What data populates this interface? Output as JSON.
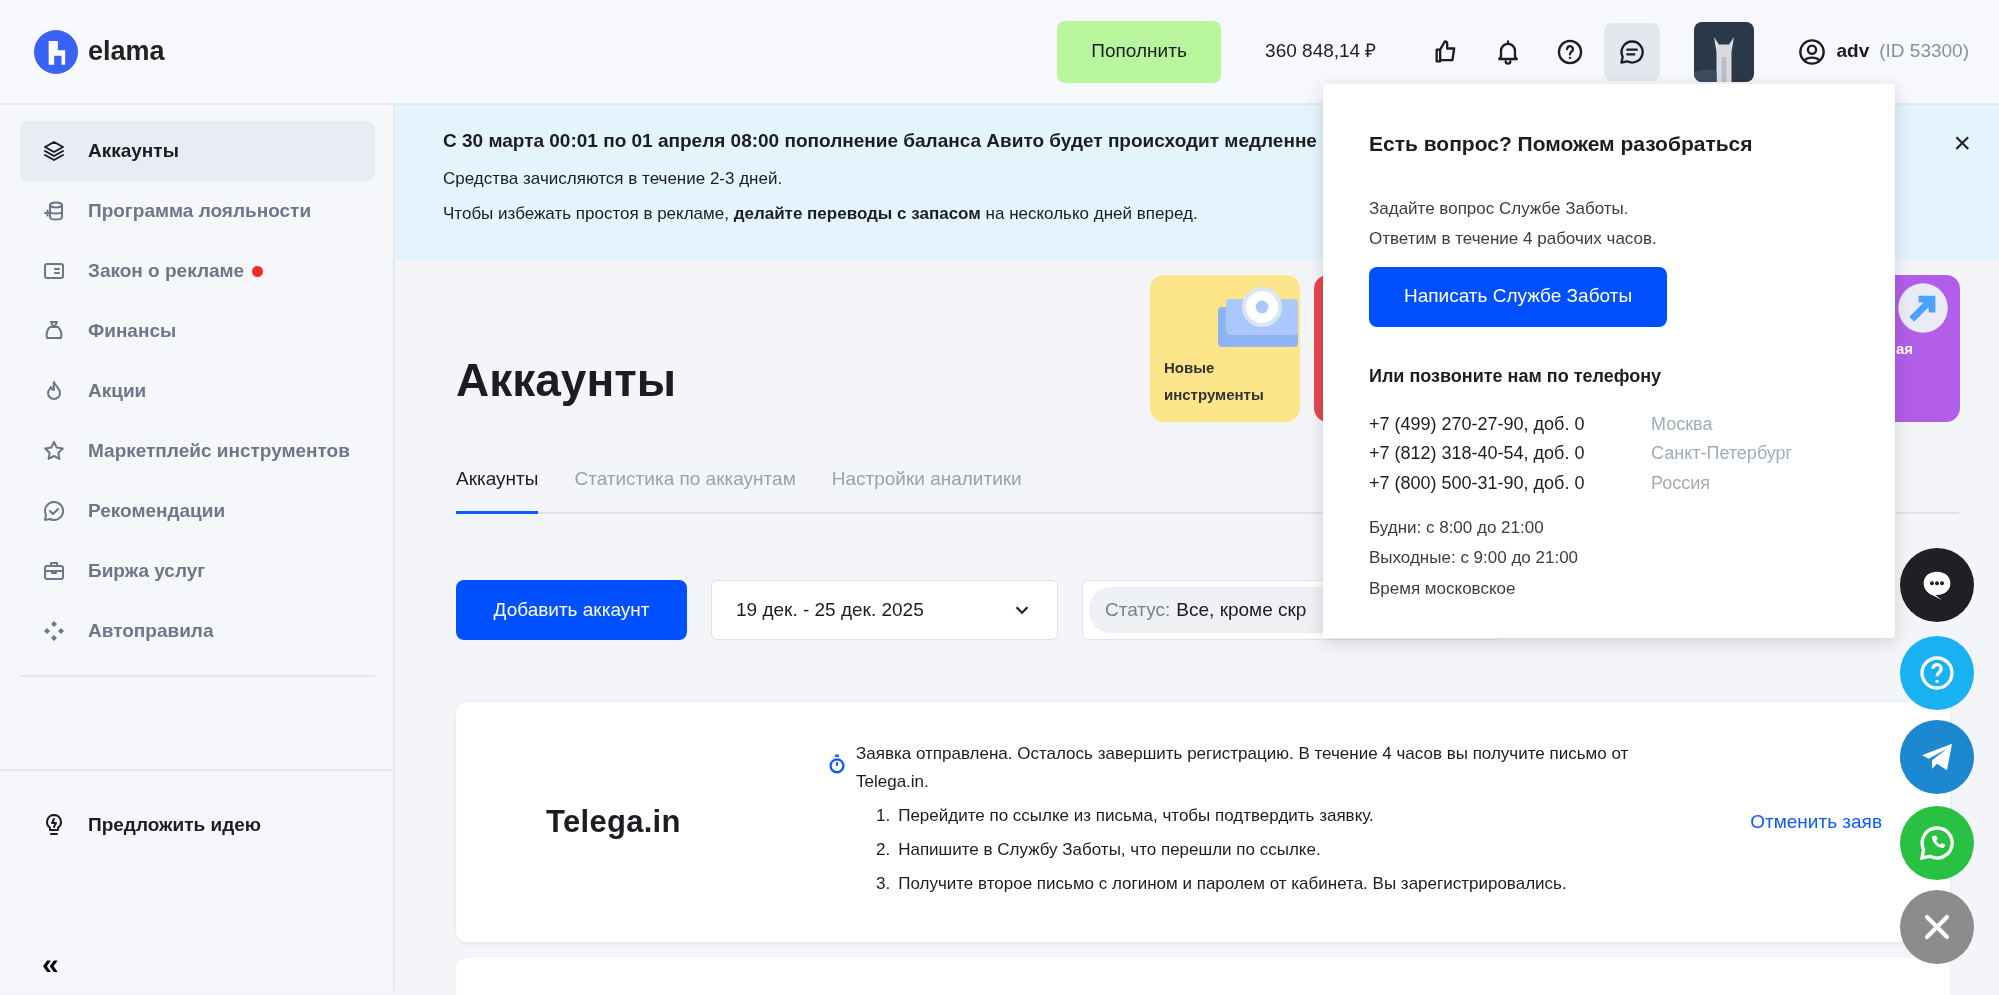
{
  "header": {
    "logo": "elama",
    "topup_button": "Пополнить",
    "balance": "360 848,14 ₽",
    "chat_open": true,
    "user": {
      "name": "adv",
      "id": "(ID 53300)"
    }
  },
  "sidebar": {
    "items": [
      {
        "label": "Аккаунты",
        "kind": "layers",
        "selected": true,
        "badge": false
      },
      {
        "label": "Программа лояльности",
        "kind": "coins",
        "selected": false,
        "badge": false
      },
      {
        "label": "Закон о рекламе",
        "kind": "card",
        "selected": false,
        "badge": true
      },
      {
        "label": "Финансы",
        "kind": "bag",
        "selected": false,
        "badge": false
      },
      {
        "label": "Акции",
        "kind": "fire",
        "selected": false,
        "badge": false
      },
      {
        "label": "Маркетплейс инструментов",
        "kind": "star",
        "selected": false,
        "badge": false
      },
      {
        "label": "Рекомендации",
        "kind": "check",
        "selected": false,
        "badge": false
      },
      {
        "label": "Биржа услуг",
        "kind": "case",
        "selected": false,
        "badge": false
      },
      {
        "label": "Автоправила",
        "kind": "diamonds",
        "selected": false,
        "badge": false
      }
    ],
    "suggest": "Предложить идею",
    "collapse": "«"
  },
  "banner": {
    "close": "×",
    "title": "С 30 марта 00:01 по 01 апреля 08:00 пополнение баланса Авито будет происходит медленне",
    "lines": [
      "Средства зачисляются в течение 2-3 дней.",
      "Чтобы избежать простоя в рекламе, **делайте переводы с запасом** на несколько дней вперед."
    ]
  },
  "promo_cards": [
    {
      "kind": "tools",
      "label": "Новые инструменты",
      "color": "#fde68a"
    },
    {
      "kind": "plain",
      "color": "#e5484d"
    },
    {
      "kind": "arrow",
      "label": "ая",
      "color": "#b35ee9"
    }
  ],
  "page_title": "Аккаунты",
  "tabs": [
    {
      "label": "Аккаунты",
      "selected": true
    },
    {
      "label": "Статистика по аккаунтам",
      "selected": false
    },
    {
      "label": "Настройки аналитики",
      "selected": false
    }
  ],
  "toolbar": {
    "add_button": "Добавить аккаунт",
    "date_range": "19 дек. - 25 дек. 2025",
    "status_label": "Статус:",
    "status_value": "Все, кроме скр"
  },
  "telega_card": {
    "logo": "Telega.in",
    "notice": "Заявка отправлена. Осталось завершить регистрацию. В течение 4 часов вы получите письмо от Telega.in.",
    "steps": [
      {
        "number": "1.",
        "text": "Перейдите по ссылке из письма, чтобы подтвердить заявку."
      },
      {
        "number": "2.",
        "text": "Напишите в Службу Заботы, что перешли по ссылке."
      },
      {
        "number": "3.",
        "text": "Получите второе письмо с логином и паролем от кабинета. Вы зарегистрировались."
      }
    ],
    "cancel_link": "Отменить заяв"
  },
  "support_popup": {
    "title": "Есть вопрос? Поможем разобраться",
    "intro": [
      "Задайте вопрос Службе Заботы.",
      "Ответим в течение 4 рабочих часов."
    ],
    "write_button": "Написать Службе Заботы",
    "phone_heading": "Или позвоните нам по телефону",
    "phones": [
      {
        "number": "+7 (499) 270-27-90, доб. 0",
        "city": "Москва"
      },
      {
        "number": "+7 (812) 318-40-54, доб. 0",
        "city": "Санкт-Петербург"
      },
      {
        "number": "+7 (800) 500-31-90, доб. 0",
        "city": "Россия"
      }
    ],
    "hours": [
      "Будни: с 8:00 до 21:00",
      "Выходные: с 9:00 до 21:00",
      "Время московское"
    ]
  },
  "floating_buttons": [
    {
      "kind": "chat"
    },
    {
      "kind": "help"
    },
    {
      "kind": "telegram"
    },
    {
      "kind": "whatsapp"
    },
    {
      "kind": "close"
    }
  ]
}
